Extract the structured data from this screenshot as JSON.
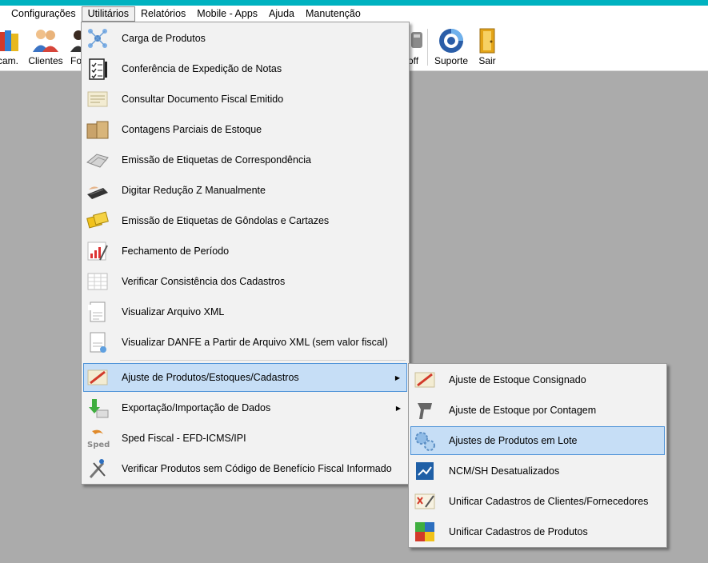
{
  "menubar": {
    "items": [
      "Configurações",
      "Utilitários",
      "Relatórios",
      "Mobile - Apps",
      "Ajuda",
      "Manutenção"
    ],
    "active_index": 1
  },
  "toolbar": {
    "buttons_left": [
      {
        "label": "cam.",
        "icon": "books-icon"
      },
      {
        "label": "Clientes",
        "icon": "people-icon"
      },
      {
        "label": "Fo",
        "icon": "person-icon"
      }
    ],
    "buttons_right": [
      {
        "label": "off",
        "icon": "power-icon"
      },
      {
        "label": "Suporte",
        "icon": "support-icon"
      },
      {
        "label": "Sair",
        "icon": "exit-door-icon"
      }
    ]
  },
  "utilitarios_menu": {
    "items": [
      {
        "label": "Carga de Produtos",
        "icon": "network-nodes-icon"
      },
      {
        "label": "Conferência de Expedição de Notas",
        "icon": "checklist-icon"
      },
      {
        "label": "Consultar Documento Fiscal Emitido",
        "icon": "document-icon"
      },
      {
        "label": "Contagens Parciais de Estoque",
        "icon": "boxes-icon"
      },
      {
        "label": "Emissão de Etiquetas de Correspondência",
        "icon": "envelopes-icon"
      },
      {
        "label": "Digitar Redução Z Manualmente",
        "icon": "keyboard-hand-icon"
      },
      {
        "label": "Emissão de Etiquetas de Gôndolas e Cartazes",
        "icon": "yellow-labels-icon"
      },
      {
        "label": "Fechamento de Período",
        "icon": "chart-pen-icon"
      },
      {
        "label": "Verificar Consistência dos Cadastros",
        "icon": "spreadsheet-icon"
      },
      {
        "label": "Visualizar Arquivo XML",
        "icon": "xml-file-icon"
      },
      {
        "label": "Visualizar DANFE a Partir de Arquivo XML (sem valor fiscal)",
        "icon": "xml-danfe-icon"
      },
      {
        "label": "Ajuste de Produtos/Estoques/Cadastros",
        "icon": "adjust-pencil-icon",
        "submenu": true
      },
      {
        "label": "Exportação/Importação de Dados",
        "icon": "export-import-icon",
        "submenu": true
      },
      {
        "label": "Sped Fiscal - EFD-ICMS/IPI",
        "icon": "sped-icon"
      },
      {
        "label": "Verificar Produtos sem Código de Benefício Fiscal Informado",
        "icon": "tools-icon"
      }
    ]
  },
  "ajuste_submenu": {
    "items": [
      {
        "label": "Ajuste de Estoque Consignado",
        "icon": "adjust-pencil-icon"
      },
      {
        "label": "Ajuste de Estoque por Contagem",
        "icon": "barcode-scanner-icon"
      },
      {
        "label": "Ajustes de Produtos em Lote",
        "icon": "gears-icon"
      },
      {
        "label": "NCM/SH Desatualizados",
        "icon": "ncm-chart-icon"
      },
      {
        "label": "Unificar Cadastros de Clientes/Fornecedores",
        "icon": "unify-clients-icon"
      },
      {
        "label": "Unificar Cadastros de Produtos",
        "icon": "puzzle-icon"
      }
    ]
  },
  "colors": {
    "top_accent": "#00b2c0",
    "desktop": "#ababab",
    "highlight_fill": "#c6def6",
    "highlight_border": "#4f93d8"
  }
}
